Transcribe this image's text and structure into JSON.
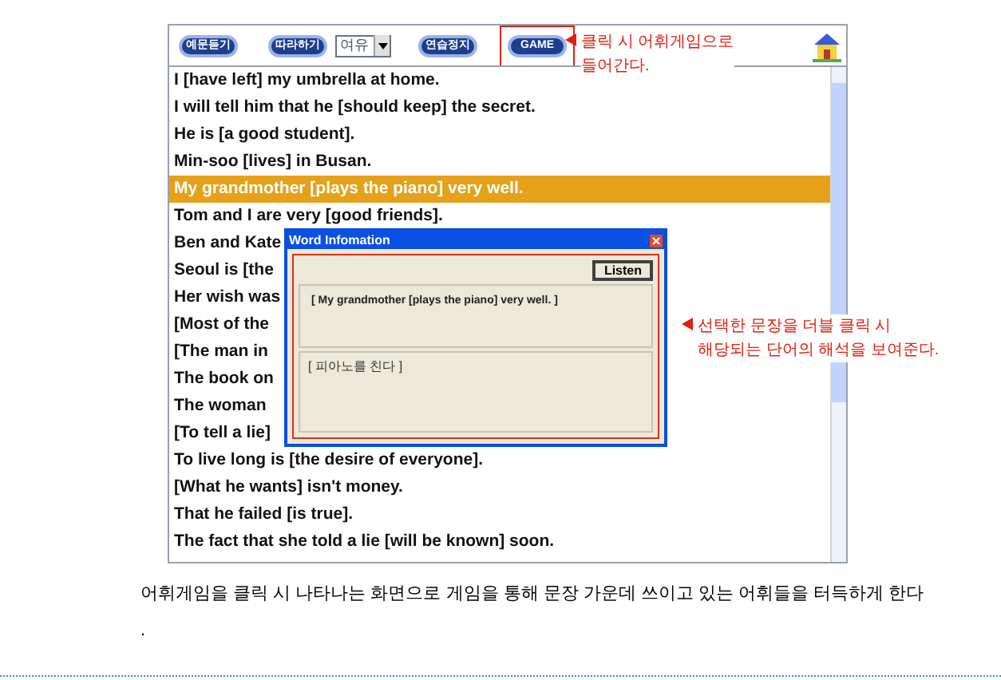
{
  "toolbar": {
    "buttons": [
      {
        "label": "예문듣기"
      },
      {
        "label": "따라하기"
      }
    ],
    "speed_select": {
      "value": "여유"
    },
    "buttons_after": [
      {
        "label": "연습정지"
      }
    ],
    "game_button": {
      "label": "GAME"
    }
  },
  "sentences": [
    {
      "text": "I [have left] my umbrella at home.",
      "selected": false
    },
    {
      "text": "I will tell him that he [should keep] the secret.",
      "selected": false
    },
    {
      "text": "He is [a good student].",
      "selected": false
    },
    {
      "text": "Min-soo [lives] in Busan.",
      "selected": false
    },
    {
      "text": "My grandmother [plays the piano] very well.",
      "selected": true
    },
    {
      "text": "Tom and I are very [good friends].",
      "selected": false
    },
    {
      "text": "Ben and Kate",
      "selected": false
    },
    {
      "text": "Seoul is [the",
      "selected": false
    },
    {
      "text": "Her wish was",
      "selected": false
    },
    {
      "text": "[Most of the",
      "selected": false
    },
    {
      "text": "[The man in",
      "selected": false
    },
    {
      "text": "The book on",
      "selected": false
    },
    {
      "text": "The woman",
      "selected": false
    },
    {
      "text": "[To tell a lie]",
      "selected": false
    },
    {
      "text": "To live long is [the desire of everyone].",
      "selected": false
    },
    {
      "text": "[What he wants] isn't money.",
      "selected": false
    },
    {
      "text": "That he failed [is true].",
      "selected": false
    },
    {
      "text": "The fact that she told a lie [will be known] soon.",
      "selected": false
    }
  ],
  "word_dialog": {
    "title": "Word Infomation",
    "listen_button": "Listen",
    "sentence": "[  My grandmother [plays the piano] very well. ]",
    "meaning": "[ 피아노를 친다 ]"
  },
  "callouts": [
    {
      "lines": [
        "클릭 시 어휘게임으로",
        "들어간다."
      ]
    },
    {
      "lines": [
        "선택한 문장을 더블 클릭 시",
        "해당되는 단어의 해석을 보여준다."
      ]
    }
  ],
  "caption": "어휘게임을 클릭 시 나타나는 화면으로 게임을 통해 문장 가운데 쓰이고 있는 어휘들을 터득하게 한다",
  "caption_end": "."
}
